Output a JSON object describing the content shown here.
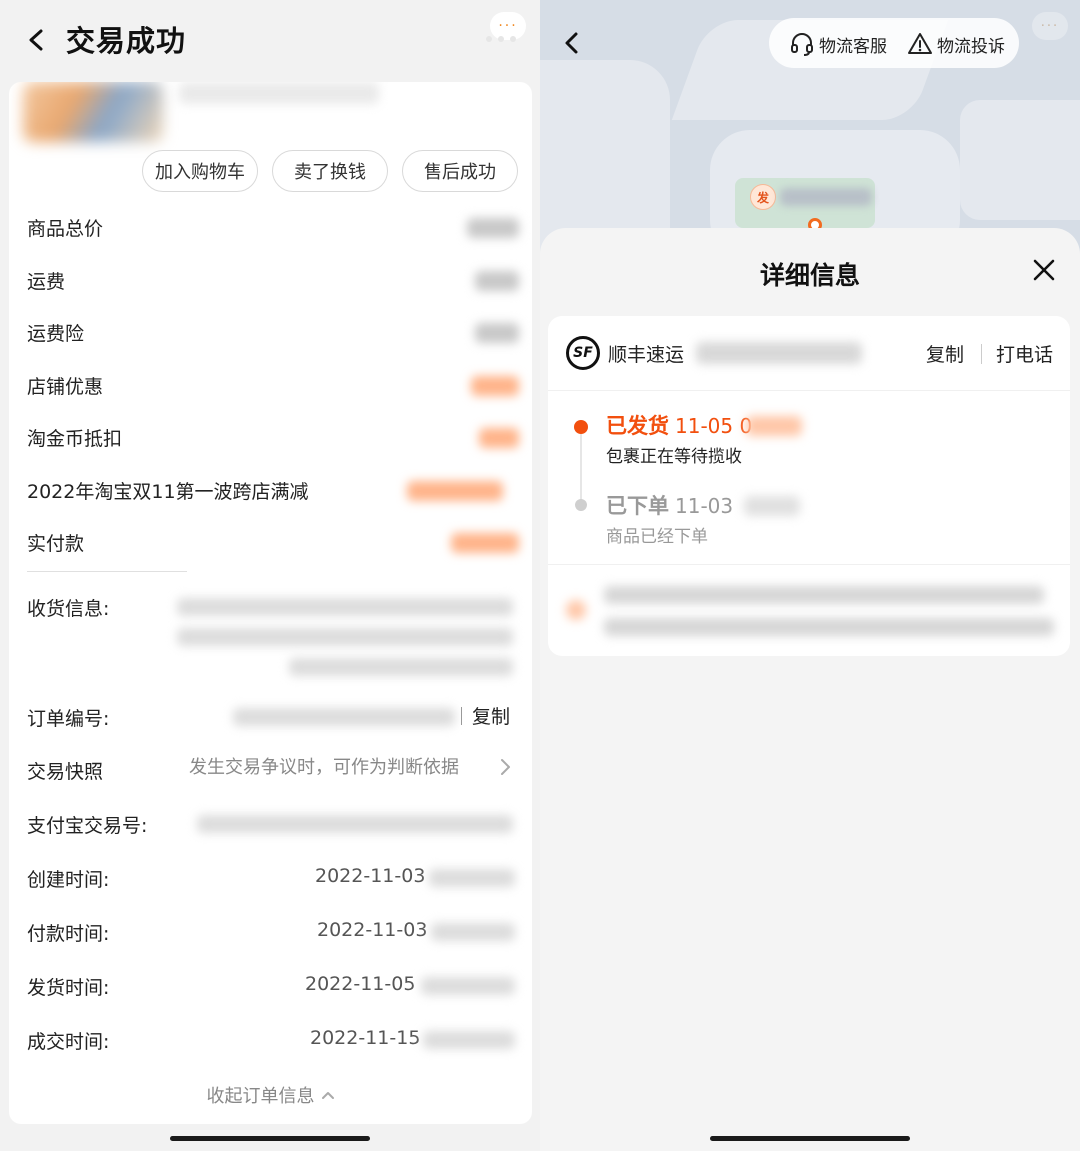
{
  "left": {
    "title": "交易成功",
    "more_label": "···",
    "actions": {
      "add_cart": "加入购物车",
      "sell": "卖了换钱",
      "after_sale": "售后成功"
    },
    "price_rows": [
      {
        "label": "商品总价"
      },
      {
        "label": "运费"
      },
      {
        "label": "运费险"
      },
      {
        "label": "店铺优惠"
      },
      {
        "label": "淘金币抵扣"
      },
      {
        "label": "2022年淘宝双11第一波跨店满减"
      },
      {
        "label": "实付款"
      }
    ],
    "info": {
      "address_label": "收货信息:",
      "order_no_label": "订单编号:",
      "copy_label": "复制",
      "snapshot_label": "交易快照",
      "snapshot_hint": "发生交易争议时，可作为判断依据",
      "alipay_label": "支付宝交易号:",
      "created_label": "创建时间:",
      "created_date": "2022-11-03",
      "paid_label": "付款时间:",
      "paid_date": "2022-11-03",
      "shipped_label": "发货时间:",
      "shipped_date": "2022-11-05",
      "closed_label": "成交时间:",
      "closed_date": "2022-11-15"
    },
    "collapse_label": "收起订单信息"
  },
  "right": {
    "services": {
      "customer_service": "物流客服",
      "complaint": "物流投诉"
    },
    "more_label": "···",
    "map_marker": "发",
    "sheet_title": "详细信息",
    "carrier": {
      "logo_text": "SF",
      "name": "顺丰速运",
      "copy": "复制",
      "call": "打电话"
    },
    "timeline": [
      {
        "status": "已发货",
        "date": "11-05 0",
        "desc": "包裹正在等待揽收"
      },
      {
        "status": "已下单",
        "date": "11-03",
        "desc": "商品已经下单"
      }
    ]
  },
  "colors": {
    "accent_orange": "#f24f0e",
    "muted_grey": "#999999"
  }
}
